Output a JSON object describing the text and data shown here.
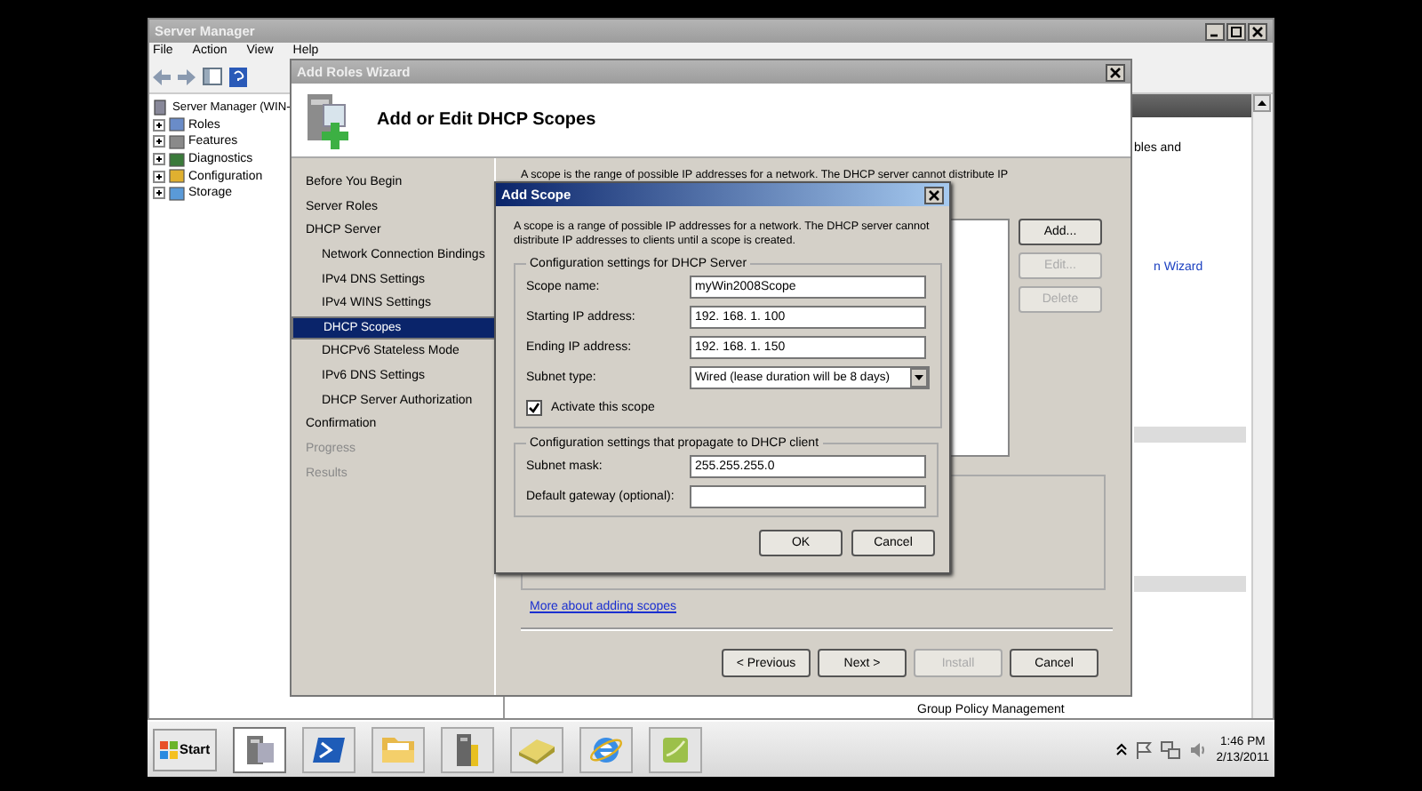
{
  "server_manager": {
    "title": "Server Manager",
    "menu": [
      "File",
      "Action",
      "View",
      "Help"
    ],
    "tree": [
      {
        "label": "Server Manager (WIN-",
        "children": [
          {
            "label": "Roles",
            "kind": "roles"
          },
          {
            "label": "Features",
            "kind": "features"
          },
          {
            "label": "Diagnostics",
            "kind": "diagnostics"
          },
          {
            "label": "Configuration",
            "kind": "configuration"
          },
          {
            "label": "Storage",
            "kind": "storage"
          }
        ]
      }
    ],
    "right_pane": {
      "text": "bles and",
      "link": "n Wizard",
      "footer_item": "Group Policy Management"
    }
  },
  "wizard": {
    "title": "Add Roles Wizard",
    "heading": "Add or Edit DHCP Scopes",
    "steps": [
      {
        "label": "Before You Begin",
        "selected": false,
        "disabled": false
      },
      {
        "label": "Server Roles",
        "selected": false,
        "disabled": false
      },
      {
        "label": "DHCP Server",
        "selected": false,
        "disabled": false,
        "children": [
          {
            "label": "Network Connection Bindings",
            "selected": false,
            "disabled": false
          },
          {
            "label": "IPv4 DNS Settings",
            "selected": false,
            "disabled": false
          },
          {
            "label": "IPv4 WINS Settings",
            "selected": false,
            "disabled": false
          },
          {
            "label": "DHCP Scopes",
            "selected": true,
            "disabled": false
          },
          {
            "label": "DHCPv6 Stateless Mode",
            "selected": false,
            "disabled": false
          },
          {
            "label": "IPv6 DNS Settings",
            "selected": false,
            "disabled": false
          },
          {
            "label": "DHCP Server Authorization",
            "selected": false,
            "disabled": false
          }
        ]
      },
      {
        "label": "Confirmation",
        "selected": false,
        "disabled": false
      },
      {
        "label": "Progress",
        "selected": false,
        "disabled": true
      },
      {
        "label": "Results",
        "selected": false,
        "disabled": true
      }
    ],
    "intro": "A scope is the range of possible IP addresses for a network. The DHCP server cannot distribute IP",
    "scope_buttons": [
      {
        "label": "Add...",
        "disabled": false
      },
      {
        "label": "Edit...",
        "disabled": true
      },
      {
        "label": "Delete",
        "disabled": true
      }
    ],
    "link": "More about adding scopes",
    "nav_buttons": [
      {
        "label": "< Previous",
        "disabled": false
      },
      {
        "label": "Next >",
        "disabled": false
      },
      {
        "label": "Install",
        "disabled": true
      },
      {
        "label": "Cancel",
        "disabled": false
      }
    ]
  },
  "dialog": {
    "title": "Add Scope",
    "description": "A scope is a range of possible IP addresses for a network. The DHCP server cannot distribute IP addresses to clients until a scope is created.",
    "groups": [
      {
        "legend": "Configuration settings for DHCP Server",
        "fields": [
          {
            "kind": "text",
            "label": "Scope name:",
            "value": "myWin2008Scope"
          },
          {
            "kind": "text",
            "label": "Starting IP address:",
            "value": "192. 168. 1. 100"
          },
          {
            "kind": "text",
            "label": "Ending IP address:",
            "value": "192. 168. 1. 150"
          },
          {
            "kind": "select",
            "label": "Subnet type:",
            "value": "Wired (lease duration will be 8 days)"
          },
          {
            "kind": "checkbox",
            "label": "Activate this scope",
            "checked": true
          }
        ]
      },
      {
        "legend": "Configuration settings that propagate to DHCP client",
        "fields": [
          {
            "kind": "text",
            "label": "Subnet mask:",
            "value": "255.255.255.0"
          },
          {
            "kind": "text",
            "label": "Default gateway (optional):"
          }
        ]
      }
    ],
    "buttons": [
      "OK",
      "Cancel"
    ]
  },
  "taskbar": {
    "start": "Start",
    "apps": [
      {
        "kind": "server",
        "selected": true
      },
      {
        "kind": "terminal",
        "selected": false
      },
      {
        "kind": "folder",
        "selected": false
      },
      {
        "kind": "tower",
        "selected": false
      },
      {
        "kind": "notebook",
        "selected": false
      },
      {
        "kind": "globe",
        "selected": false
      },
      {
        "kind": "book",
        "selected": false
      }
    ],
    "time": "1:46 PM",
    "date": "2/13/2011"
  }
}
